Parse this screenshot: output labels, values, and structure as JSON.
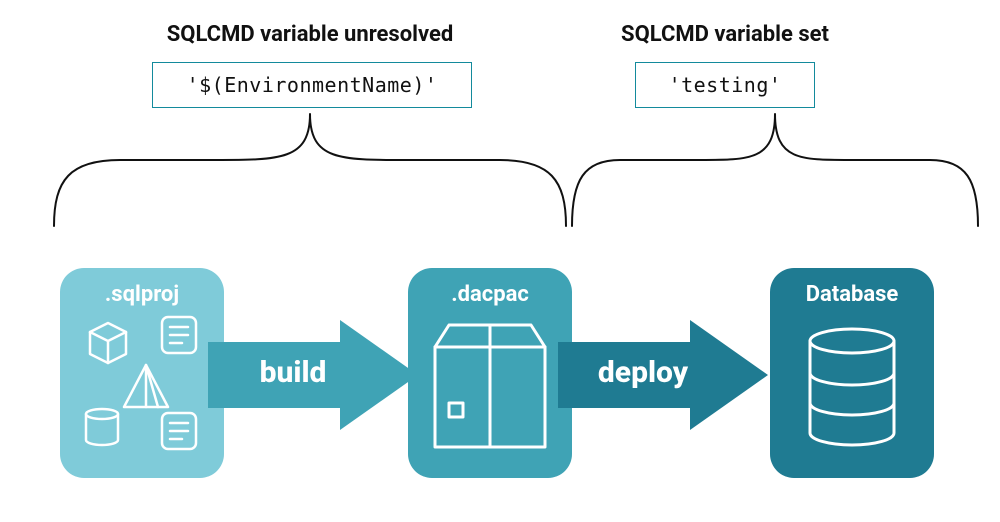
{
  "diagram": {
    "sections": {
      "left": {
        "title": "SQLCMD variable unresolved",
        "value": "'$(EnvironmentName)'"
      },
      "right": {
        "title": "SQLCMD variable set",
        "value": "'testing'"
      }
    },
    "nodes": {
      "sqlproj": {
        "label": ".sqlproj"
      },
      "dacpac": {
        "label": ".dacpac"
      },
      "database": {
        "label": "Database"
      }
    },
    "edges": {
      "build": {
        "label": "build"
      },
      "deploy": {
        "label": "deploy"
      }
    },
    "colors": {
      "sqlproj_bg": "#7fcbd9",
      "dacpac_bg": "#3fa3b5",
      "database_bg": "#1f7b92",
      "chip_border": "#138a9c",
      "text": "#111111",
      "white": "#ffffff",
      "build_fill": "#3fa3b5",
      "deploy_fill": "#1f7b92"
    }
  }
}
